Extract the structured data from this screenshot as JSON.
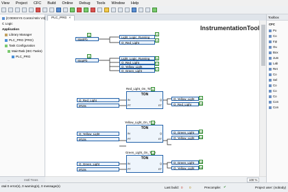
{
  "menu": [
    "View",
    "Project",
    "CFC",
    "Build",
    "Online",
    "Debug",
    "Tools",
    "Window",
    "Help"
  ],
  "left_tree": {
    "items": [
      {
        "label": "[CODESYS Control Win V3]"
      },
      {
        "label": "C Logic"
      },
      {
        "label": "Application"
      },
      {
        "label": "Library Manager"
      },
      {
        "label": "PLC_PRG (PRG)"
      },
      {
        "label": "Task Configuration"
      },
      {
        "label": "MainTask (IEC-Tasks)"
      },
      {
        "label": "PLC_PRG"
      }
    ],
    "footer_left": "...",
    "footer_right": "Instl Trees"
  },
  "editor_tab": {
    "label": "PLC_PRG"
  },
  "watermark": "InstrumentationTools.com",
  "diagram": {
    "in1": "StartPb",
    "out1a": "Light_Logic_Running",
    "out1b": "O_Red_Light",
    "in2": "StopPb",
    "out2a": "Light_Logic_Running",
    "out2b": "O_Red_Light",
    "out2c": "O_Yellow_Light",
    "out2d": "O_Green_Light",
    "tmr1": {
      "instance": "Red_Light_On_Time",
      "type": "TON",
      "in_var": "O_Red_Light",
      "pt_var": "t#10s",
      "out1": "O_Yellow_Light",
      "out2": "O_Red_Light",
      "pin_in": "IN",
      "pin_pt": "PT",
      "pin_q": "Q",
      "pin_et": "ET"
    },
    "tmr2": {
      "instance": "Yellow_Light_On_Time",
      "type": "TON",
      "in_var": "O_Yellow_Light",
      "pt_var": "t#10s",
      "out1": "O_Green_Light",
      "out2": "O_Yellow_Light",
      "pin_in": "IN",
      "pin_pt": "PT",
      "pin_q": "Q",
      "pin_et": "ET"
    },
    "tmr3": {
      "instance": "Green_Light_On_Time",
      "type": "TON",
      "in_var": "O_Green_Light",
      "pt_var": "t#10s",
      "out1": "O_Green_Light",
      "out2": "O_Yellow_Light",
      "pin_in": "IN",
      "pin_pt": "PT",
      "pin_q": "Q",
      "pin_et": "ET"
    },
    "nums": [
      "1",
      "2",
      "3",
      "4",
      "5",
      "6",
      "7",
      "8",
      "9",
      "10",
      "11",
      "12",
      "13",
      "14",
      "15",
      "16",
      "17",
      "18"
    ]
  },
  "zoom": "100 %",
  "toolbox": {
    "title": "Toolbox",
    "section": "CFC",
    "items": [
      "Po",
      "Co",
      "Inp",
      "Ou",
      "Box",
      "Jum",
      "Lab",
      "Ret",
      "Co",
      "Sel",
      "Co",
      "Co",
      "Co",
      "Con",
      "Con"
    ]
  },
  "status": {
    "messages": "otal 0 error(s), 0 warning(s), 0 message(s)",
    "last_build": "Last build:",
    "errors": "0",
    "warnings": "0",
    "precompile": "Precompile:",
    "project_user": "Project user: (nobody)"
  },
  "colors": {
    "accent": "#1f5fa8",
    "number_badge": "#2e8b2e"
  }
}
